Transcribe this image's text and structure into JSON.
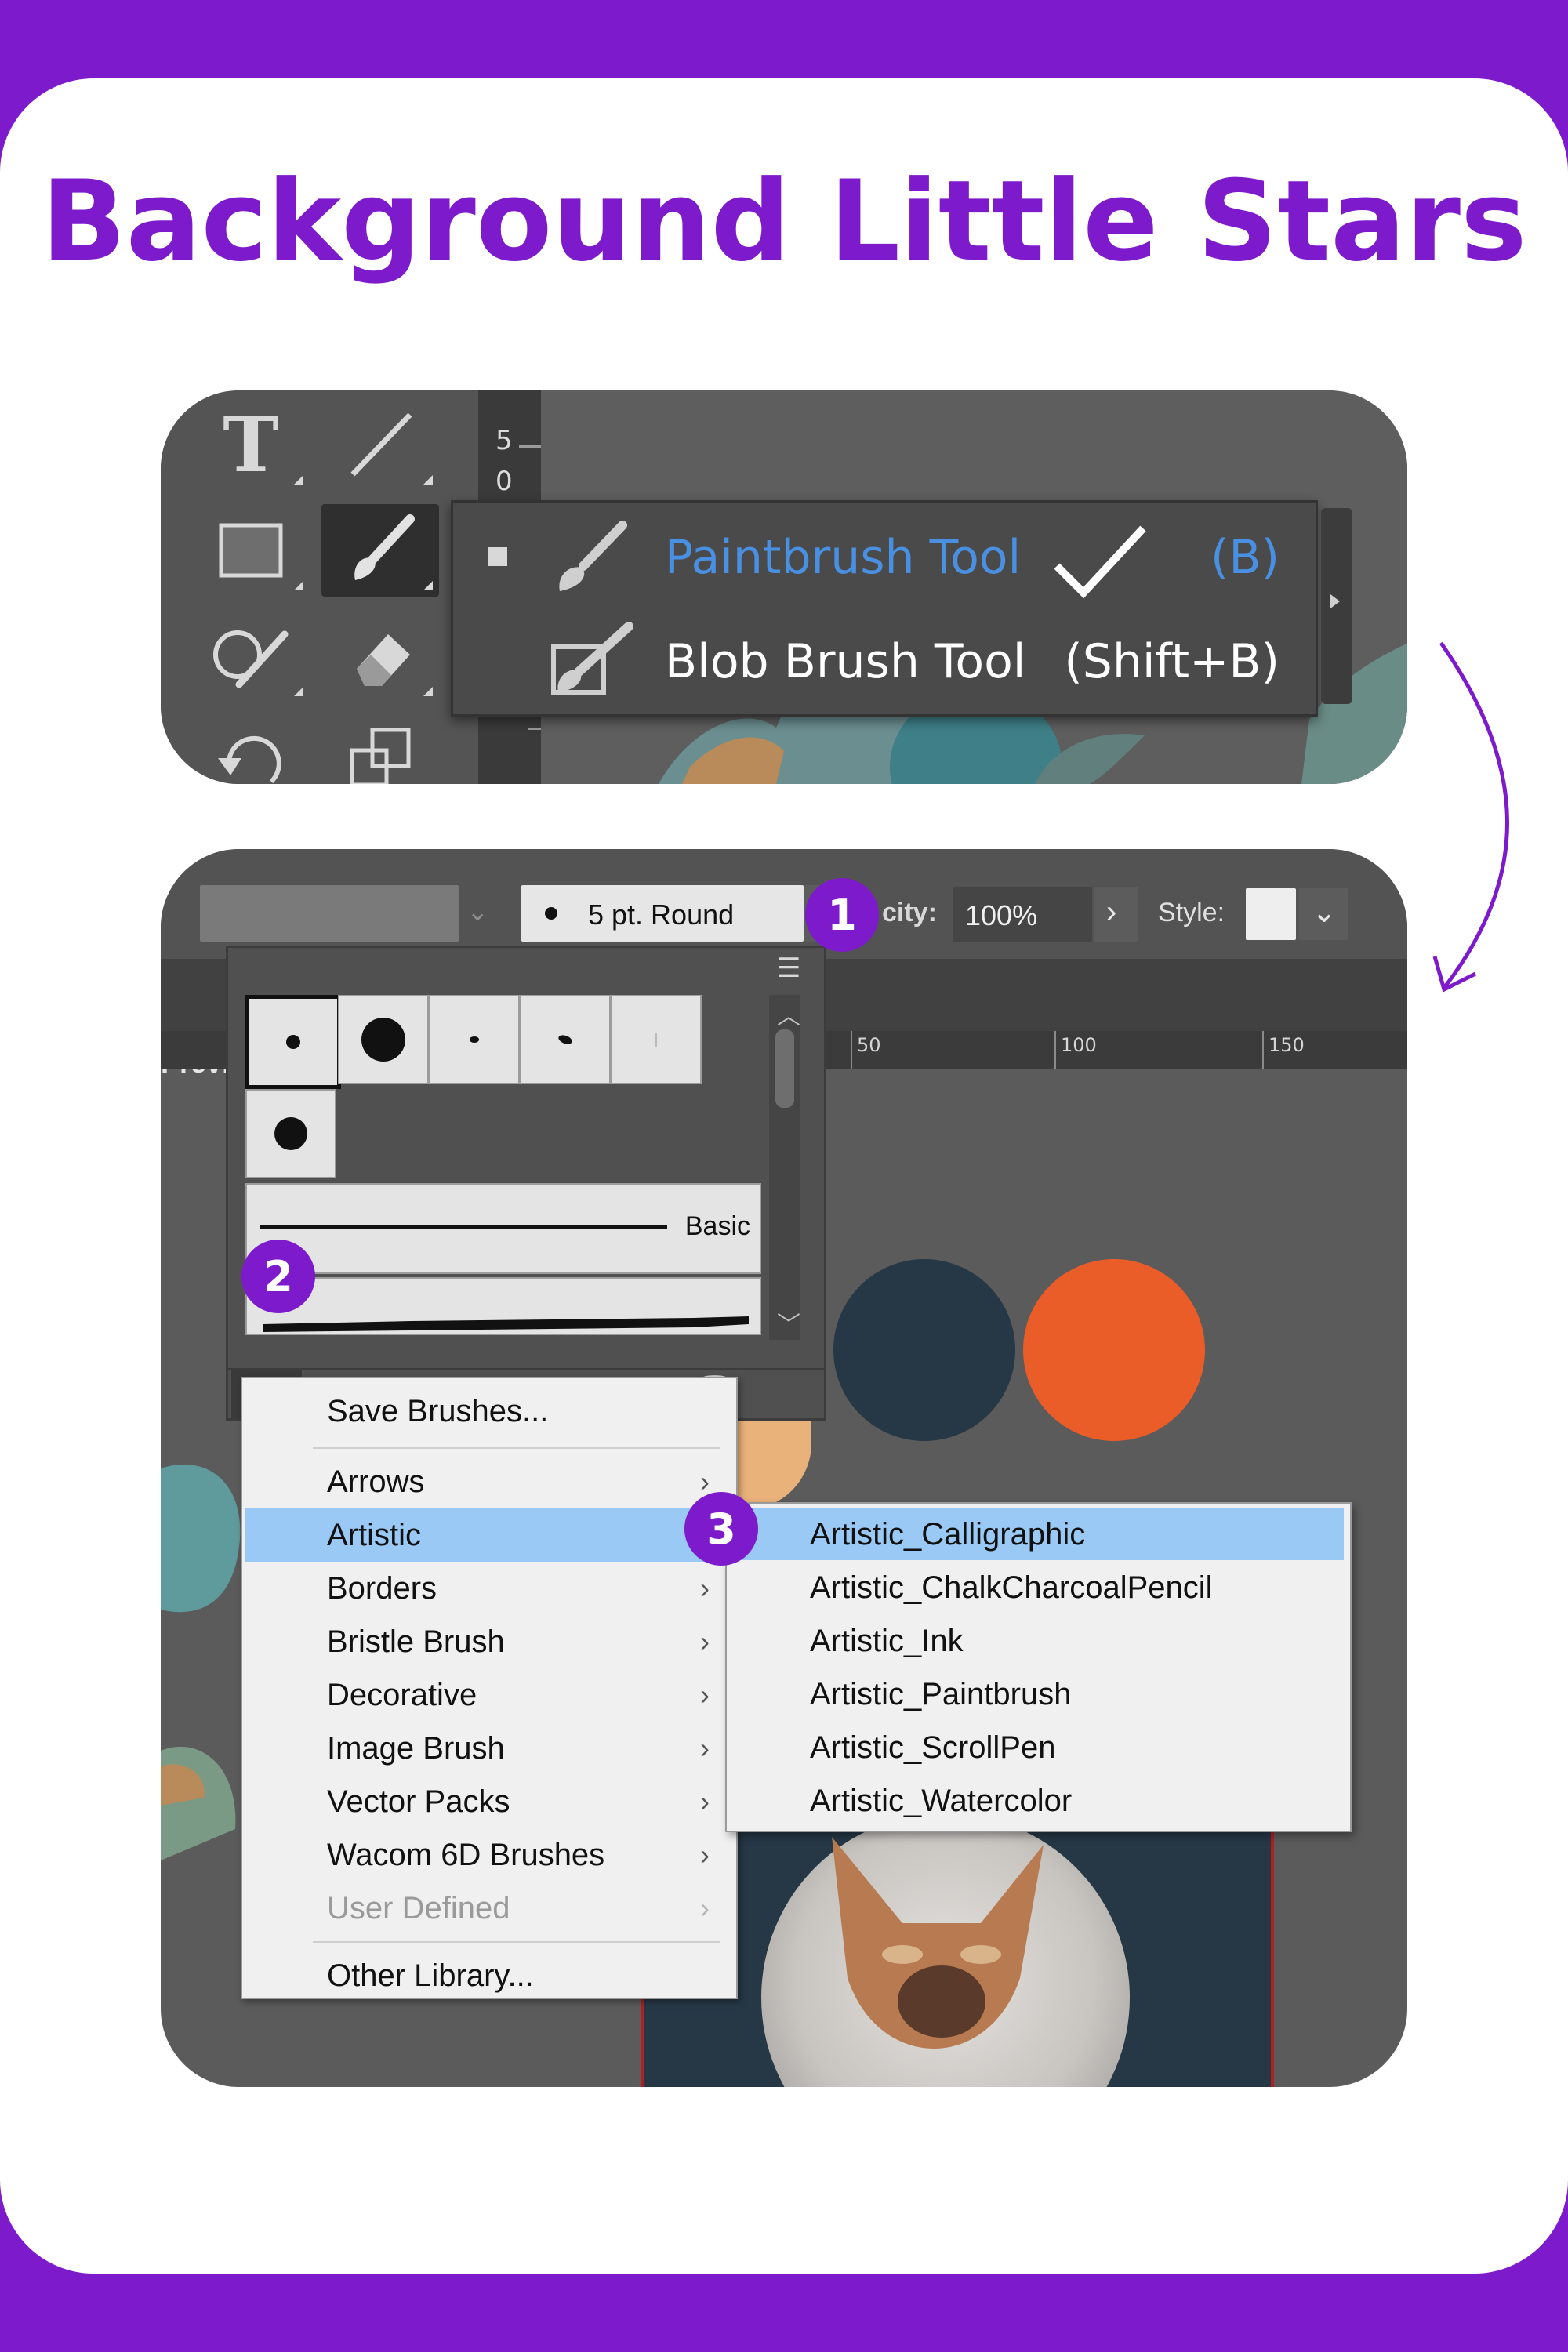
{
  "page": {
    "title": "Background Little Stars"
  },
  "tool_flyout": {
    "items": [
      {
        "name": "Paintbrush Tool",
        "shortcut": "(B)",
        "selected": true
      },
      {
        "name": "Blob Brush Tool",
        "shortcut": "(Shift+B)",
        "selected": false
      }
    ],
    "ruler_marks": [
      "5",
      "0"
    ]
  },
  "control_bar": {
    "brush_definition": "5 pt. Round",
    "opacity_label": "city:",
    "opacity_value": "100%",
    "style_label": "Style:",
    "preview_label": "Previ"
  },
  "ruler": {
    "labels": [
      "50",
      "100",
      "150"
    ]
  },
  "brushes_panel": {
    "stroke_label": "Basic"
  },
  "library_menu": {
    "items": [
      {
        "label": "Save Brushes...",
        "arrow": ""
      },
      {
        "label": "Arrows",
        "arrow": "›"
      },
      {
        "label": "Artistic",
        "arrow": "›",
        "highlighted": true
      },
      {
        "label": "Borders",
        "arrow": "›"
      },
      {
        "label": "Bristle Brush",
        "arrow": "›"
      },
      {
        "label": "Decorative",
        "arrow": "›"
      },
      {
        "label": "Image Brush",
        "arrow": "›"
      },
      {
        "label": "Vector Packs",
        "arrow": "›"
      },
      {
        "label": "Wacom 6D Brushes",
        "arrow": "›"
      },
      {
        "label": "User Defined",
        "arrow": "›",
        "disabled": true
      },
      {
        "label": "Other Library...",
        "arrow": ""
      }
    ]
  },
  "artistic_submenu": {
    "items": [
      "Artistic_Calligraphic",
      "Artistic_ChalkCharcoalPencil",
      "Artistic_Ink",
      "Artistic_Paintbrush",
      "Artistic_ScrollPen",
      "Artistic_Watercolor"
    ]
  },
  "steps": {
    "step1": "1",
    "step2": "2",
    "step3": "3"
  },
  "colors": {
    "accent": "#7d1bcc",
    "highlight_blue": "#4a90e2",
    "menu_highlight": "#99c9f4",
    "swatch_navy": "#263746",
    "swatch_orange": "#ea5d28",
    "swatch_peach": "#e9b27a"
  }
}
